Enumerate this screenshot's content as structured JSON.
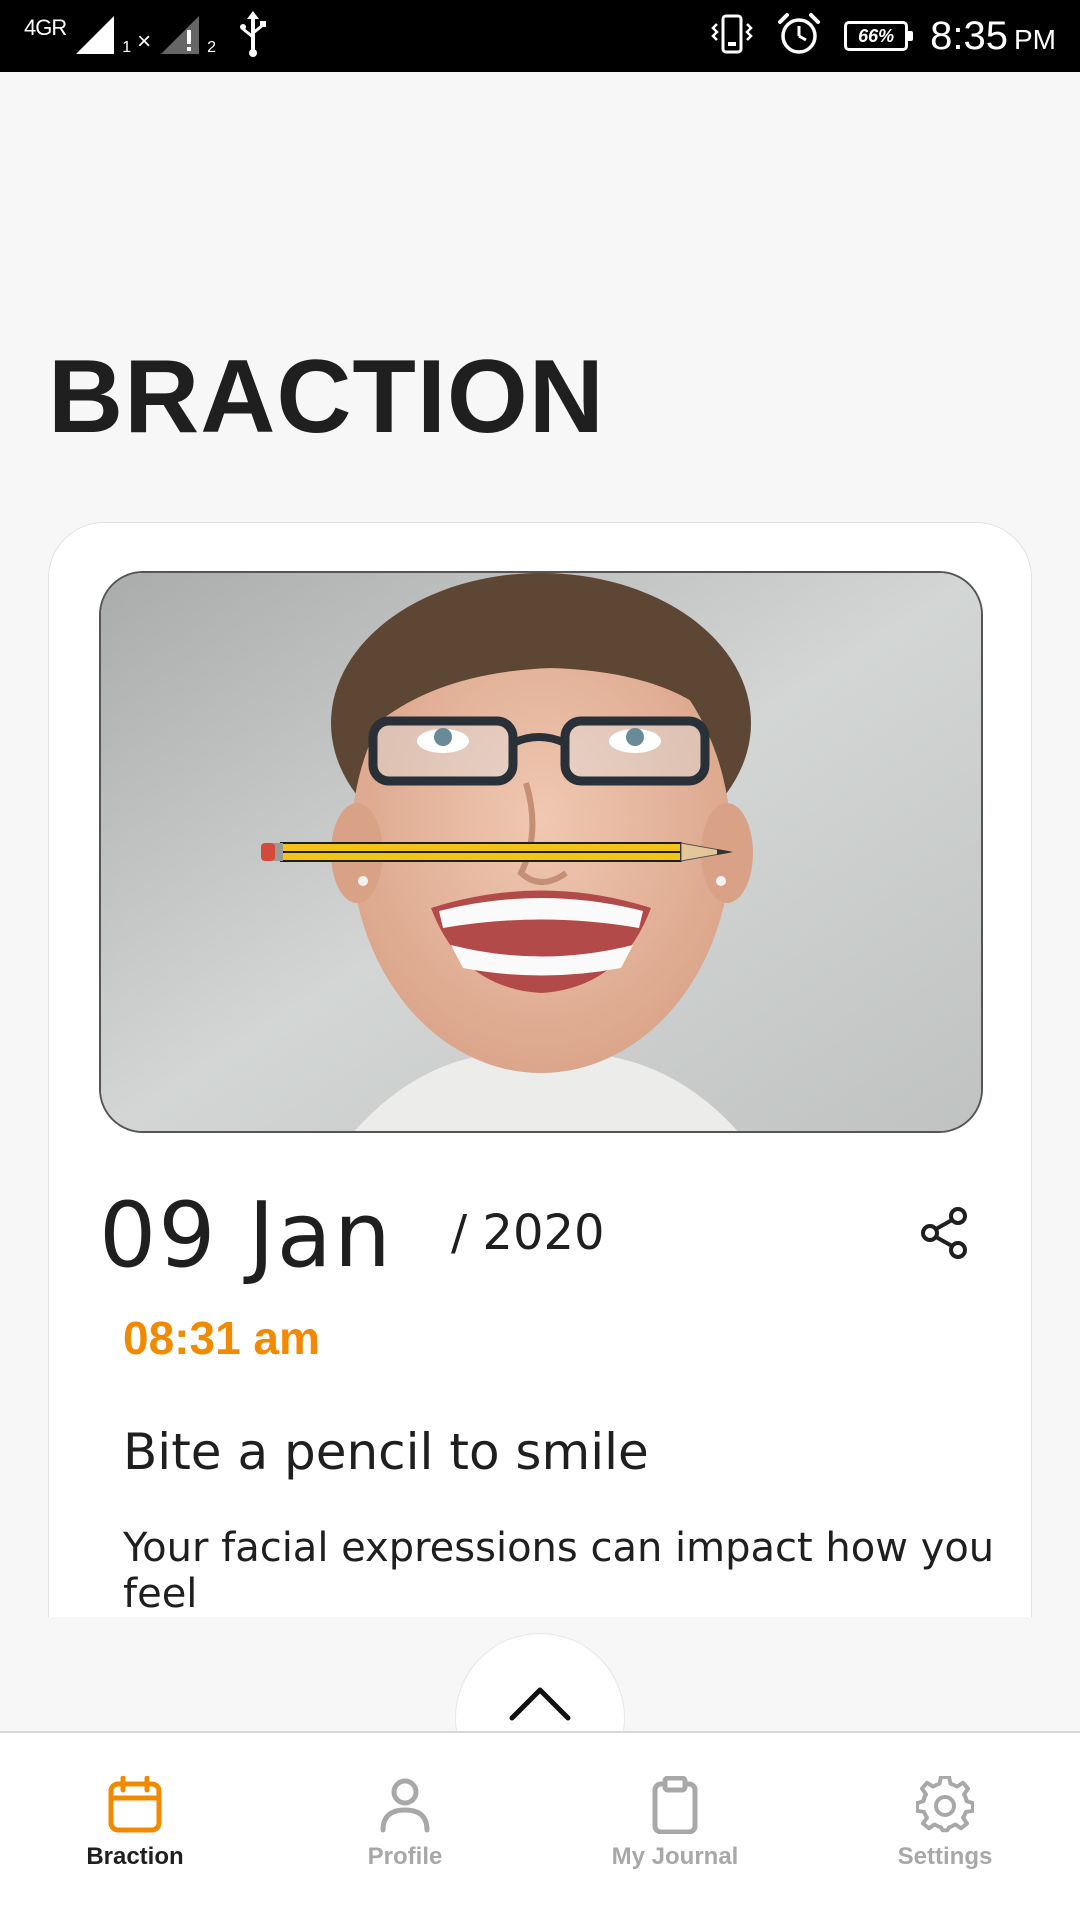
{
  "status_bar": {
    "network_label": "4GR",
    "sim1_label": "1",
    "sim2_label": "2",
    "battery_percent": "66%",
    "time": "8:35",
    "ampm": "PM",
    "icons": [
      "signal-icon",
      "no-signal-icon",
      "usb-icon",
      "vibrate-icon",
      "alarm-icon",
      "battery-icon"
    ]
  },
  "app": {
    "title": "BRACTION"
  },
  "card": {
    "image_alt": "Woman biting a pencil to smile",
    "date_day": "09 Jan",
    "date_year": "/ 2020",
    "time": "08:31 am",
    "tip_title": "Bite a pencil to smile",
    "tip_description": "Your facial expressions can impact how you feel",
    "share_icon": "share-icon"
  },
  "expand": {
    "icon": "chevron-up-icon"
  },
  "bottom_nav": {
    "items": [
      {
        "label": "Braction",
        "icon": "calendar-icon",
        "active": true
      },
      {
        "label": "Profile",
        "icon": "person-icon",
        "active": false
      },
      {
        "label": "My Journal",
        "icon": "clipboard-icon",
        "active": false
      },
      {
        "label": "Settings",
        "icon": "gear-icon",
        "active": false
      }
    ]
  },
  "colors": {
    "accent": "#f18a00",
    "inactive": "#a8a8a8",
    "text": "#1f1f1f",
    "background": "#f7f7f7"
  }
}
